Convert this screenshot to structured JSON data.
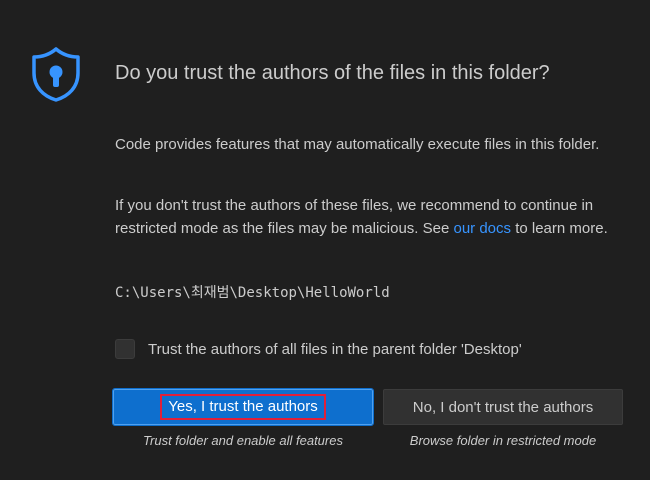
{
  "dialog": {
    "icon": "shield-lock-icon",
    "title": "Do you trust the authors of the files in this folder?",
    "paragraph1": "Code provides features that may automatically execute files in this folder.",
    "paragraph2_before": "If you don't trust the authors of these files, we recommend to continue in restricted mode as the files may be malicious. See ",
    "paragraph2_link": "our docs",
    "paragraph2_after": " to learn more.",
    "folder_path": "C:\\Users\\최재범\\Desktop\\HelloWorld",
    "checkbox_label": "Trust the authors of all files in the parent folder 'Desktop'",
    "checkbox_checked": false
  },
  "buttons": {
    "trust_label": "Yes, I trust the authors",
    "trust_caption": "Trust folder and enable all features",
    "distrust_label": "No, I don't trust the authors",
    "distrust_caption": "Browse folder in restricted mode"
  },
  "colors": {
    "background": "#1f1f1f",
    "primary_button": "#0e6fce",
    "link": "#3794ff",
    "shield": "#3794ff",
    "highlight_box": "#e0203a"
  }
}
